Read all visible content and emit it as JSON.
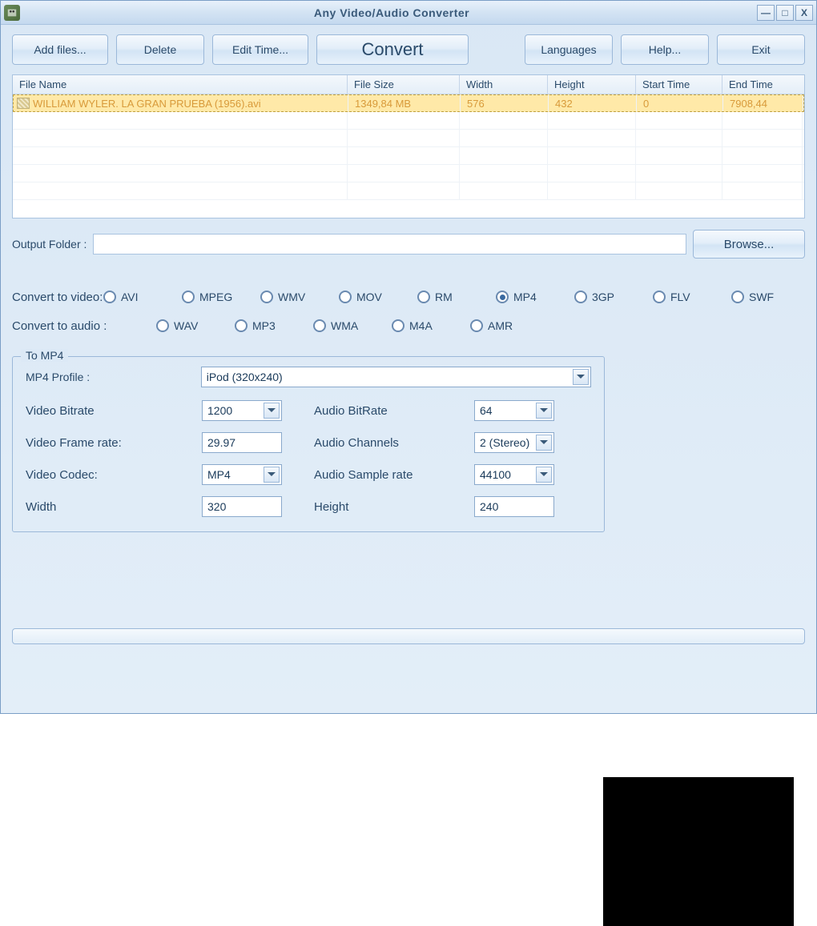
{
  "window": {
    "title": "Any Video/Audio Converter"
  },
  "toolbar": {
    "add": "Add files...",
    "delete": "Delete",
    "edit_time": "Edit Time...",
    "convert": "Convert",
    "languages": "Languages",
    "help": "Help...",
    "exit": "Exit"
  },
  "table": {
    "headers": {
      "name": "File Name",
      "size": "File Size",
      "width": "Width",
      "height": "Height",
      "start": "Start Time",
      "end": "End Time"
    },
    "rows": [
      {
        "name": "WILLIAM WYLER. LA GRAN PRUEBA (1956).avi",
        "size": "1349,84 MB",
        "width": "576",
        "height": "432",
        "start": "0",
        "end": "7908,44"
      }
    ]
  },
  "output": {
    "label": "Output Folder :",
    "browse": "Browse..."
  },
  "radios": {
    "video_label": "Convert to video:",
    "audio_label": "Convert to audio :",
    "video": [
      "AVI",
      "MPEG",
      "WMV",
      "MOV",
      "RM",
      "MP4",
      "3GP",
      "FLV",
      "SWF"
    ],
    "audio": [
      "WAV",
      "MP3",
      "WMA",
      "M4A",
      "AMR"
    ],
    "video_selected": "MP4"
  },
  "fieldset": {
    "legend": "To MP4",
    "profile_label": "MP4 Profile :",
    "profile_value": "iPod (320x240)",
    "video_bitrate_label": "Video Bitrate",
    "video_bitrate": "1200",
    "audio_bitrate_label": "Audio BitRate",
    "audio_bitrate": "64",
    "frame_rate_label": "Video Frame rate:",
    "frame_rate": "29.97",
    "channels_label": "Audio Channels",
    "channels": "2 (Stereo)",
    "codec_label": "Video Codec:",
    "codec": "MP4",
    "sample_rate_label": "Audio Sample rate",
    "sample_rate": "44100",
    "width_label": "Width",
    "width": "320",
    "height_label": "Height",
    "height": "240"
  }
}
